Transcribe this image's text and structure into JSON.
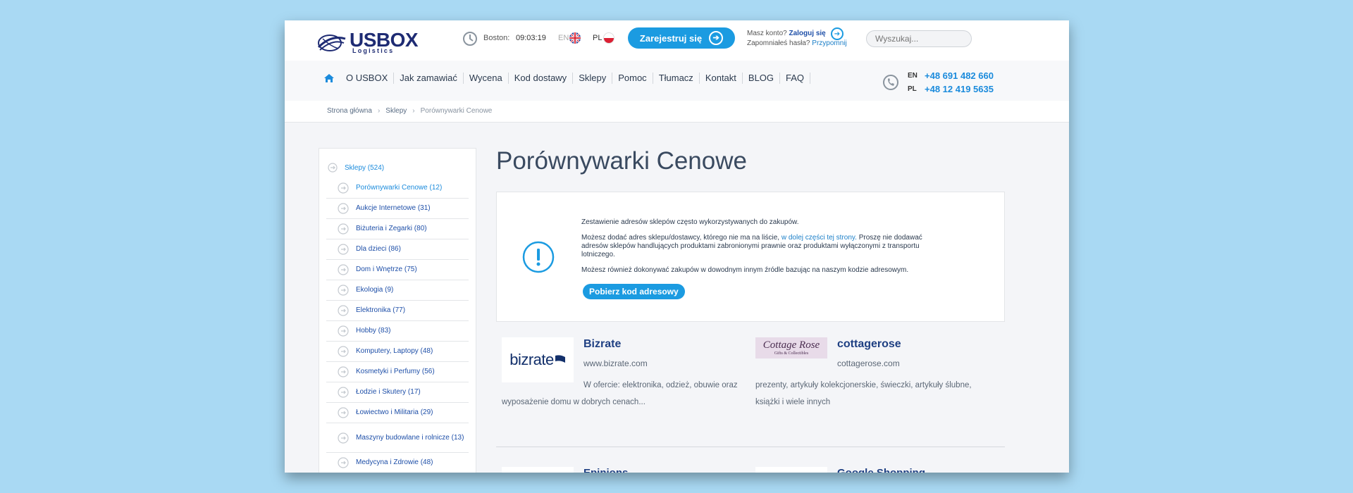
{
  "header": {
    "logo_main": "USBOX",
    "logo_sub": "Logistics",
    "city": "Boston:",
    "time": "09:03:19",
    "lang_en": "EN",
    "lang_pl": "PL",
    "register_label": "Zarejestruj się",
    "account_question": "Masz konto?",
    "login_label": "Zaloguj się",
    "forgot_label": "Zapomniałeś hasła?",
    "remind_label": "Przypomnij",
    "search_placeholder": "Wyszukaj..."
  },
  "nav": {
    "items": [
      "O USBOX",
      "Jak zamawiać",
      "Wycena",
      "Kod dostawy",
      "Sklepy",
      "Pomoc",
      "Tłumacz",
      "Kontakt",
      "BLOG",
      "FAQ"
    ],
    "phones": [
      {
        "code": "EN",
        "number": "+48 691 482 660"
      },
      {
        "code": "PL",
        "number": "+48 12 419 5635"
      }
    ]
  },
  "breadcrumb": {
    "home": "Strona główna",
    "shops": "Sklepy",
    "current": "Porównywarki Cenowe"
  },
  "sidebar": {
    "root": "Sklepy (524)",
    "items": [
      "Porównywarki Cenowe (12)",
      "Aukcje Internetowe (31)",
      "Biżuteria i Zegarki (80)",
      "Dla dzieci (86)",
      "Dom i Wnętrze (75)",
      "Ekologia (9)",
      "Elektronika (77)",
      "Hobby (83)",
      "Komputery, Laptopy (48)",
      "Kosmetyki i Perfumy (56)",
      "Łodzie i Skutery (17)",
      "Łowiectwo i Militaria (29)",
      "Maszyny budowlane i rolnicze (13)",
      "Medycyna i Zdrowie (48)"
    ]
  },
  "main": {
    "title": "Porównywarki Cenowe",
    "info": {
      "p1": "Zestawienie adresów sklepów często wykorzystywanych do zakupów.",
      "p2a": "Możesz dodać adres sklepu/dostawcy, którego nie ma na liście,",
      "p2link": "w dolej części tej strony.",
      "p2b": "Proszę nie dodawać adresów sklepów handlujących produktami zabronionymi prawnie oraz produktami wyłączonymi z transportu lotniczego.",
      "p3": "Możesz również dokonywać zakupów w dowodnym innym źródle bazując na naszym kodzie adresowym.",
      "button": "Pobierz kod adresowy"
    },
    "shops": [
      {
        "name": "Bizrate",
        "url": "www.bizrate.com",
        "logo_text": "bizrate",
        "desc": "W ofercie: elektronika, odzież, obuwie oraz wyposażenie domu w dobrych cenach..."
      },
      {
        "name": "cottagerose",
        "url": "cottagerose.com",
        "logo_text": "Cottage Rose",
        "logo_sub": "Gifts & Collectibles",
        "desc": "prezenty, artykuły kolekcjonerskie, świeczki, artykuły ślubne, książki i wiele innych"
      }
    ],
    "next_shops": [
      "Epinions",
      "Google Shopping"
    ]
  }
}
